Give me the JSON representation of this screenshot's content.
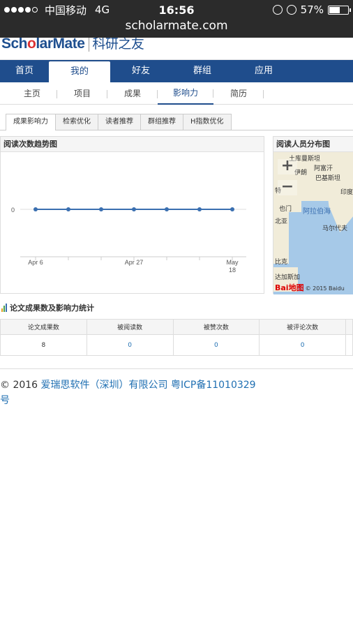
{
  "status_bar": {
    "carrier": "中国移动",
    "network": "4G",
    "time": "16:56",
    "battery": "57%"
  },
  "browser": {
    "url": "scholarmate.com"
  },
  "logo": {
    "brand_prefix": "Sch",
    "brand_o": "o",
    "brand_suffix": "larMate",
    "cn": "科研之友"
  },
  "main_nav": [
    {
      "label": "首页"
    },
    {
      "label": "我的"
    },
    {
      "label": "好友"
    },
    {
      "label": "群组"
    },
    {
      "label": "应用"
    }
  ],
  "sub_nav": [
    {
      "label": "主页"
    },
    {
      "label": "项目"
    },
    {
      "label": "成果"
    },
    {
      "label": "影响力"
    },
    {
      "label": "简历"
    }
  ],
  "tabs": [
    {
      "label": "成果影响力"
    },
    {
      "label": "检索优化"
    },
    {
      "label": "读者推荐"
    },
    {
      "label": "群组推荐"
    },
    {
      "label": "H指数优化"
    }
  ],
  "trend_panel": {
    "title": "阅读次数趋势图"
  },
  "chart_data": {
    "type": "line",
    "x": [
      "Apr 6",
      "",
      "",
      "Apr 27",
      "",
      "",
      "May 18"
    ],
    "series": [
      {
        "values": [
          0,
          0,
          0,
          0,
          0,
          0,
          0
        ]
      }
    ],
    "y_ticks": [
      "0"
    ],
    "x_tick_labels": [
      "Apr 6",
      "Apr 27",
      "May 18"
    ],
    "x_tick_labels_line1": [
      "Apr 6",
      "Apr 27",
      "May"
    ],
    "x_tick_labels_line2": [
      "",
      "",
      "18"
    ],
    "color": "#3a6fb0"
  },
  "map_panel": {
    "title": "阅读人员分布图",
    "labels": [
      "土库曼斯坦",
      "阿富汗",
      "伊朗",
      "巴基斯坦",
      "特",
      "印度",
      "也门",
      "阿拉伯海",
      "北亚",
      "马尔代夫",
      "比克",
      "达加斯加"
    ],
    "attribution": "© 2015 Baidu"
  },
  "stats": {
    "title": "论文成果数及影响力统计",
    "headers": [
      "论文成果数",
      "被阅读数",
      "被赞次数",
      "被评论次数"
    ],
    "values": [
      "8",
      "0",
      "0",
      "0"
    ]
  },
  "footer": {
    "copyright": "© 2016 ",
    "company": "爱瑞思软件（深圳）有限公司",
    "icp": "粤ICP备11010329",
    "icp_suffix": "号"
  }
}
